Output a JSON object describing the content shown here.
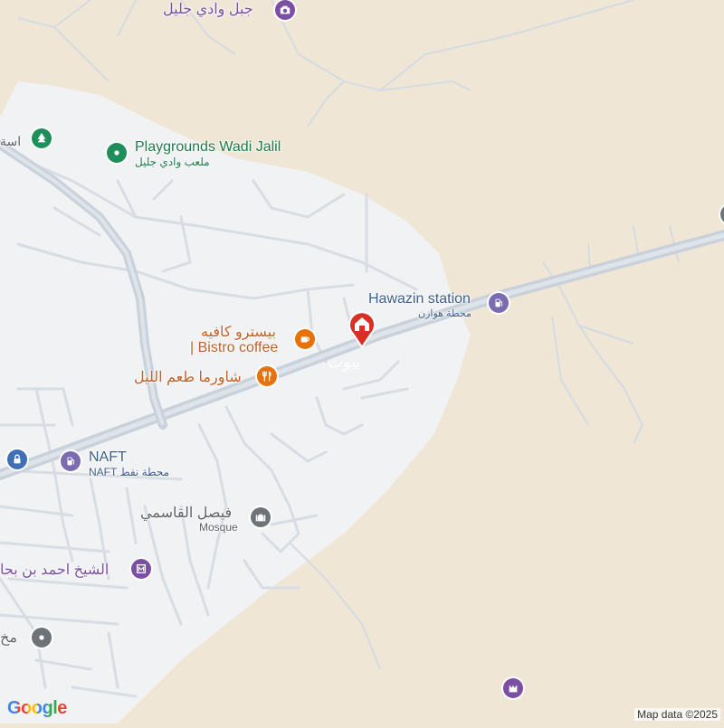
{
  "map": {
    "labels": {
      "jabal_wadi_jalil": "جبل وادي جليل",
      "playgrounds_en": "Playgrounds Wadi Jalil",
      "playgrounds_ar": "ملعب وادي جليل",
      "hawazin_en": "Hawazin station",
      "hawazin_ar": "محطة هوازن",
      "bistro_ar": "بيسترو كافيه",
      "bistro_en": "| Bistro coffee",
      "shawarma": "شاورما طعم الليل",
      "naft_title": "NAFT",
      "naft_sub": "NAFT محطة نفط",
      "faisal": "فيصل القاسمي",
      "mosque": "Mosque",
      "sheikh": "الشيخ احمد بن بحا",
      "left_edge_top": "اسة",
      "left_edge_bottom": "مخ",
      "watermark": "بيوت"
    },
    "colors": {
      "land": "#efe6d6",
      "urban": "#f1f2f4",
      "road": "#d7dde3",
      "highway": "#c9d1da",
      "marker_red": "#d93025",
      "poi_purple": "#7b4fa1",
      "poi_green": "#1e8e5a",
      "poi_gray": "#6e7378",
      "poi_orange": "#e8710a"
    },
    "icons": [
      "camera-icon",
      "tree-icon",
      "park-icon",
      "gas-station-icon",
      "home-marker-icon",
      "cafe-icon",
      "restaurant-icon",
      "lock-icon",
      "mosque-icon",
      "landmark-icon",
      "place-icon",
      "castle-icon"
    ]
  },
  "footer": {
    "brand": "Google",
    "attribution": "Map data ©2025"
  }
}
